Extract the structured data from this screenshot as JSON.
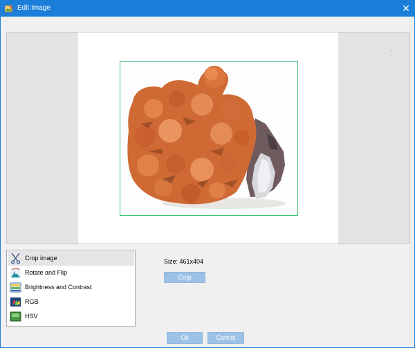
{
  "window": {
    "title": "Edit Image",
    "close_glyph": "✕",
    "accent_color": "#1b7fd9"
  },
  "editor": {
    "image_subject": "orange barite mineral specimen with quartz crystal",
    "crop_border_color": "#3cbf7a"
  },
  "tools": [
    {
      "label": "Crop image",
      "icon": "scissors-icon",
      "selected": true
    },
    {
      "label": "Rotate and Flip",
      "icon": "rotate-flip-icon",
      "selected": false
    },
    {
      "label": "Brightness and Contrast",
      "icon": "brightness-contrast-icon",
      "selected": false
    },
    {
      "label": "RGB",
      "icon": "rgb-icon",
      "selected": false
    },
    {
      "label": "HSV",
      "icon": "hsv-icon",
      "selected": false
    }
  ],
  "crop_panel": {
    "size_text": "Size: 461x404",
    "crop_button": "Crop"
  },
  "footer": {
    "ok_button": "Ok",
    "cancel_button": "Cancel"
  }
}
